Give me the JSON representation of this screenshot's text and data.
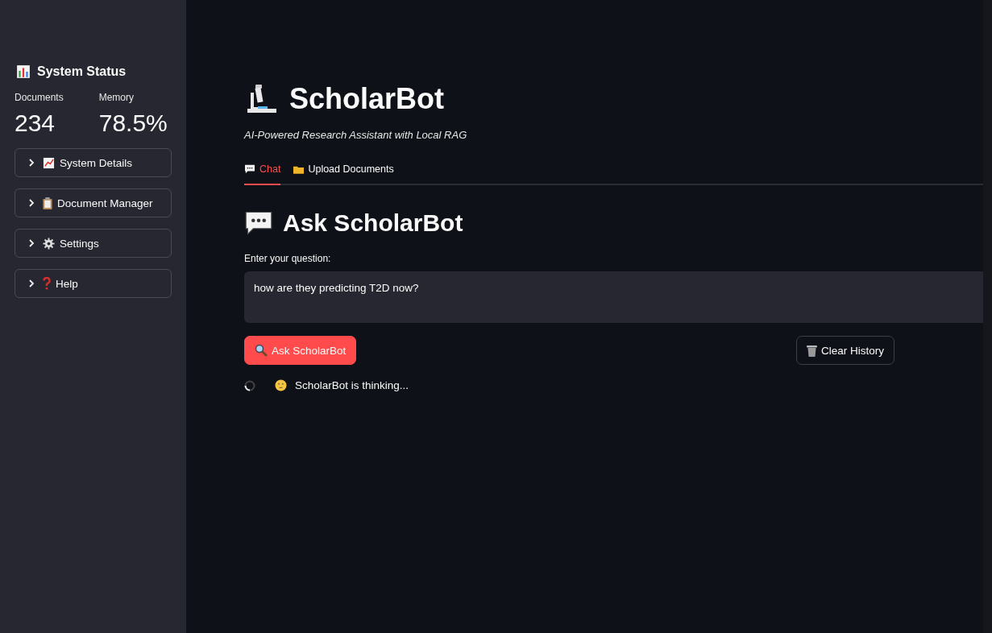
{
  "sidebar": {
    "title": "System Status",
    "metrics": [
      {
        "label": "Documents",
        "value": "234"
      },
      {
        "label": "Memory",
        "value": "78.5%"
      }
    ],
    "expanders": [
      {
        "label": "System Details",
        "expanded": false
      },
      {
        "label": "Document Manager",
        "expanded": false
      },
      {
        "label": "Settings",
        "expanded": false
      },
      {
        "label": "Help",
        "expanded": false
      }
    ]
  },
  "header": {
    "title": "ScholarBot",
    "subtitle": "AI-Powered Research Assistant with Local RAG"
  },
  "tabs": [
    {
      "label": "Chat",
      "selected": true
    },
    {
      "label": "Upload Documents",
      "selected": false
    }
  ],
  "section_title": "Ask ScholarBot",
  "question": {
    "label": "Enter your question:",
    "value": "how are they predicting T2D now?"
  },
  "buttons": [
    {
      "label": "Ask ScholarBot",
      "kind": "primary"
    },
    {
      "label": "Clear History",
      "kind": "secondary"
    }
  ],
  "status": {
    "text": "ScholarBot is thinking..."
  }
}
